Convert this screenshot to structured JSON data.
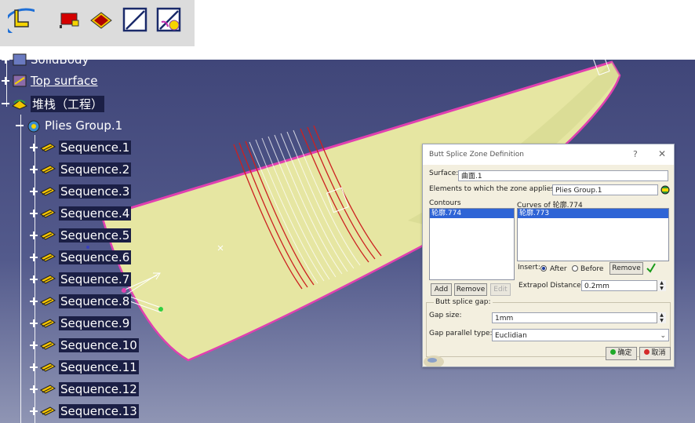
{
  "toolbar": {
    "icons": [
      "ply-table-icon",
      "flag-icon",
      "ply-book-icon",
      "slash-square-icon",
      "composite-zone-icon"
    ]
  },
  "tree": {
    "partial_item": "SolidBody",
    "items": [
      {
        "label": "Top surface",
        "underline": true
      },
      {
        "label": "堆栈（工程）"
      },
      {
        "label": "Plies Group.1"
      },
      {
        "label": "Sequence.1"
      },
      {
        "label": "Sequence.2"
      },
      {
        "label": "Sequence.3"
      },
      {
        "label": "Sequence.4"
      },
      {
        "label": "Sequence.5"
      },
      {
        "label": "Sequence.6"
      },
      {
        "label": "Sequence.7"
      },
      {
        "label": "Sequence.8"
      },
      {
        "label": "Sequence.9"
      },
      {
        "label": "Sequence.10"
      },
      {
        "label": "Sequence.11"
      },
      {
        "label": "Sequence.12"
      },
      {
        "label": "Sequence.13"
      }
    ]
  },
  "dialog": {
    "title": "Butt Splice Zone Definition",
    "help": "?",
    "close": "✕",
    "surface_label": "Surface:",
    "surface_value": "曲面.1",
    "elements_label": "Elements to which the zone applies:",
    "elements_value": "Plies Group.1",
    "contours_label": "Contours",
    "contours": [
      "轮廓.774"
    ],
    "curves_label": "Curves of 轮廓.774",
    "curves": [
      "轮廓.773"
    ],
    "add": "Add",
    "remove": "Remove",
    "edit": "Edit",
    "insert_label": "Insert:",
    "after_label": "After",
    "before_label": "Before",
    "insert_selected": "After",
    "remove2": "Remove",
    "extrapol_label": "Extrapol Distance:",
    "extrapol_value": "0.2mm",
    "butt_gap_label": "Butt splice gap:",
    "gap_size_label": "Gap size:",
    "gap_size_value": "1mm",
    "gap_type_label": "Gap parallel type:",
    "gap_type_value": "Euclidian",
    "ok": "确定",
    "cancel": "取消"
  }
}
